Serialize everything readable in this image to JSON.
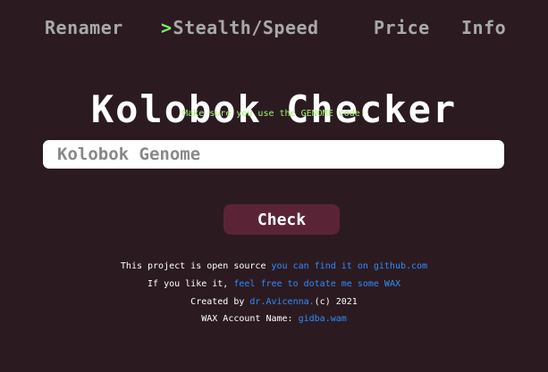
{
  "nav": {
    "renamer": "Renamer",
    "active_caret": ">",
    "stealth_speed": "Stealth/Speed",
    "price": "Price",
    "info": "Info"
  },
  "header": {
    "title": "Kolobok Checker",
    "hint": "Make sure you use the GENOME code!"
  },
  "search": {
    "placeholder": "Kolobok Genome",
    "value": ""
  },
  "actions": {
    "check_label": "Check"
  },
  "footer": {
    "line1_text": "This project is open source ",
    "line1_link": "you can find it on github.com",
    "line2_text": "If you like it, ",
    "line2_link": "feel free to dotate me some WAX",
    "line3_text_before": "Created by ",
    "line3_link": "dr.Avicenna.",
    "line3_text_after": "(c) 2021",
    "line4_text": "WAX Account Name: ",
    "line4_link": "gidba.wam"
  },
  "colors": {
    "background": "#2b1b21",
    "accent_green": "#7cf26a",
    "hint_green": "#a2f26e",
    "link_blue": "#2f8bff",
    "button_bg": "#5a2436",
    "nav_gray": "#a9a9a9"
  }
}
